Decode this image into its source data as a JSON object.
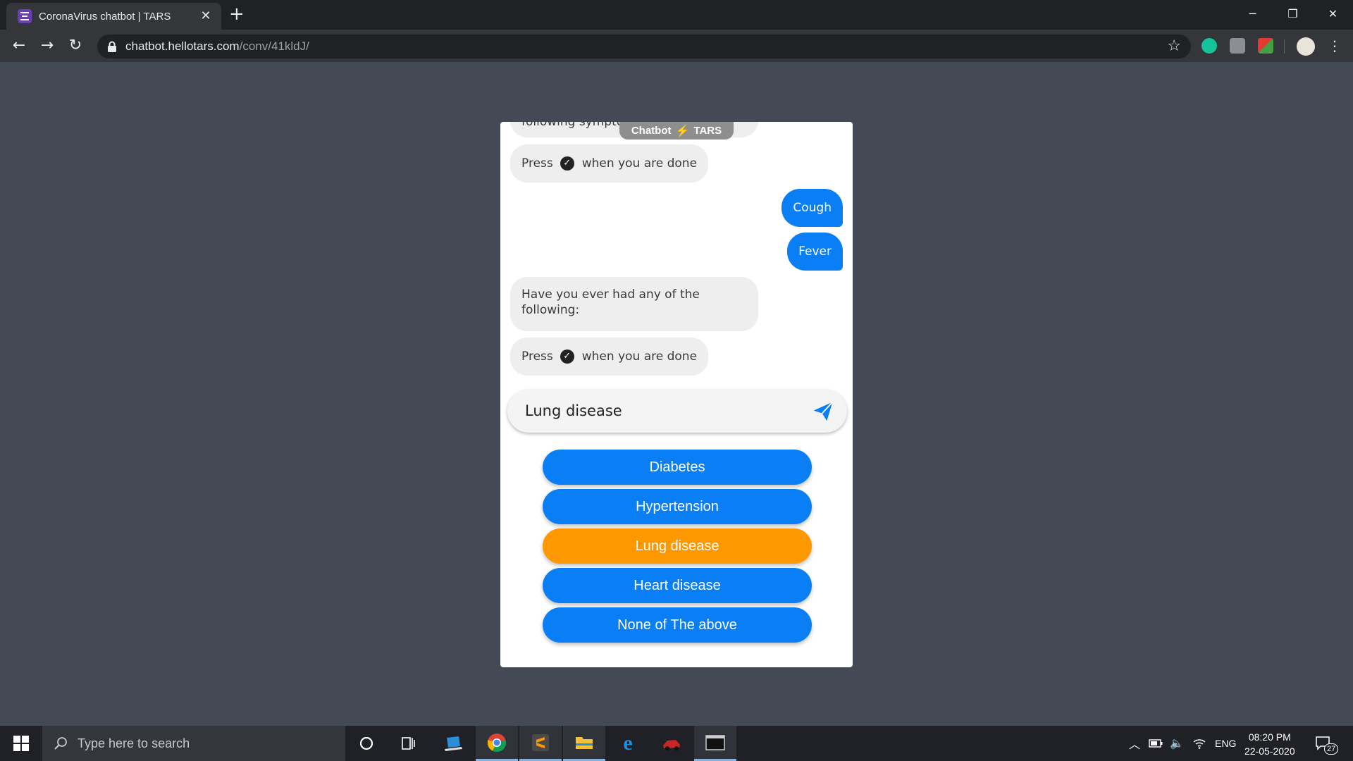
{
  "browser": {
    "tab_title": "CoronaVirus chatbot | TARS",
    "url_host": "chatbot.hellotars.com",
    "url_path": "/conv/41kldJ/"
  },
  "chat": {
    "brand": {
      "left": "Chatbot",
      "bolt": "⚡",
      "right": "TARS"
    },
    "cutoff_text": "following sympto",
    "messages": {
      "press_1": {
        "before": "Press",
        "after": "when you are done"
      },
      "user_cough": "Cough",
      "user_fever": "Fever",
      "question": "Have you ever had any of the following:",
      "press_2": {
        "before": "Press",
        "after": "when you are done"
      }
    },
    "input_value": "Lung disease",
    "options": [
      {
        "label": "Diabetes",
        "color": "#0a7ef5"
      },
      {
        "label": "Hypertension",
        "color": "#0a7ef5"
      },
      {
        "label": "Lung disease",
        "color": "#ff9800"
      },
      {
        "label": "Heart disease",
        "color": "#0a7ef5"
      },
      {
        "label": "None of The above",
        "color": "#0a7ef5"
      }
    ]
  },
  "taskbar": {
    "search_placeholder": "Type here to search",
    "language": "ENG",
    "time": "08:20 PM",
    "date": "22-05-2020",
    "notification_count": "27"
  },
  "colors": {
    "page_bg": "#434a55",
    "bot_bubble": "#eeeeee",
    "user_bubble": "#0a7ef5",
    "selected_option": "#ff9800"
  }
}
